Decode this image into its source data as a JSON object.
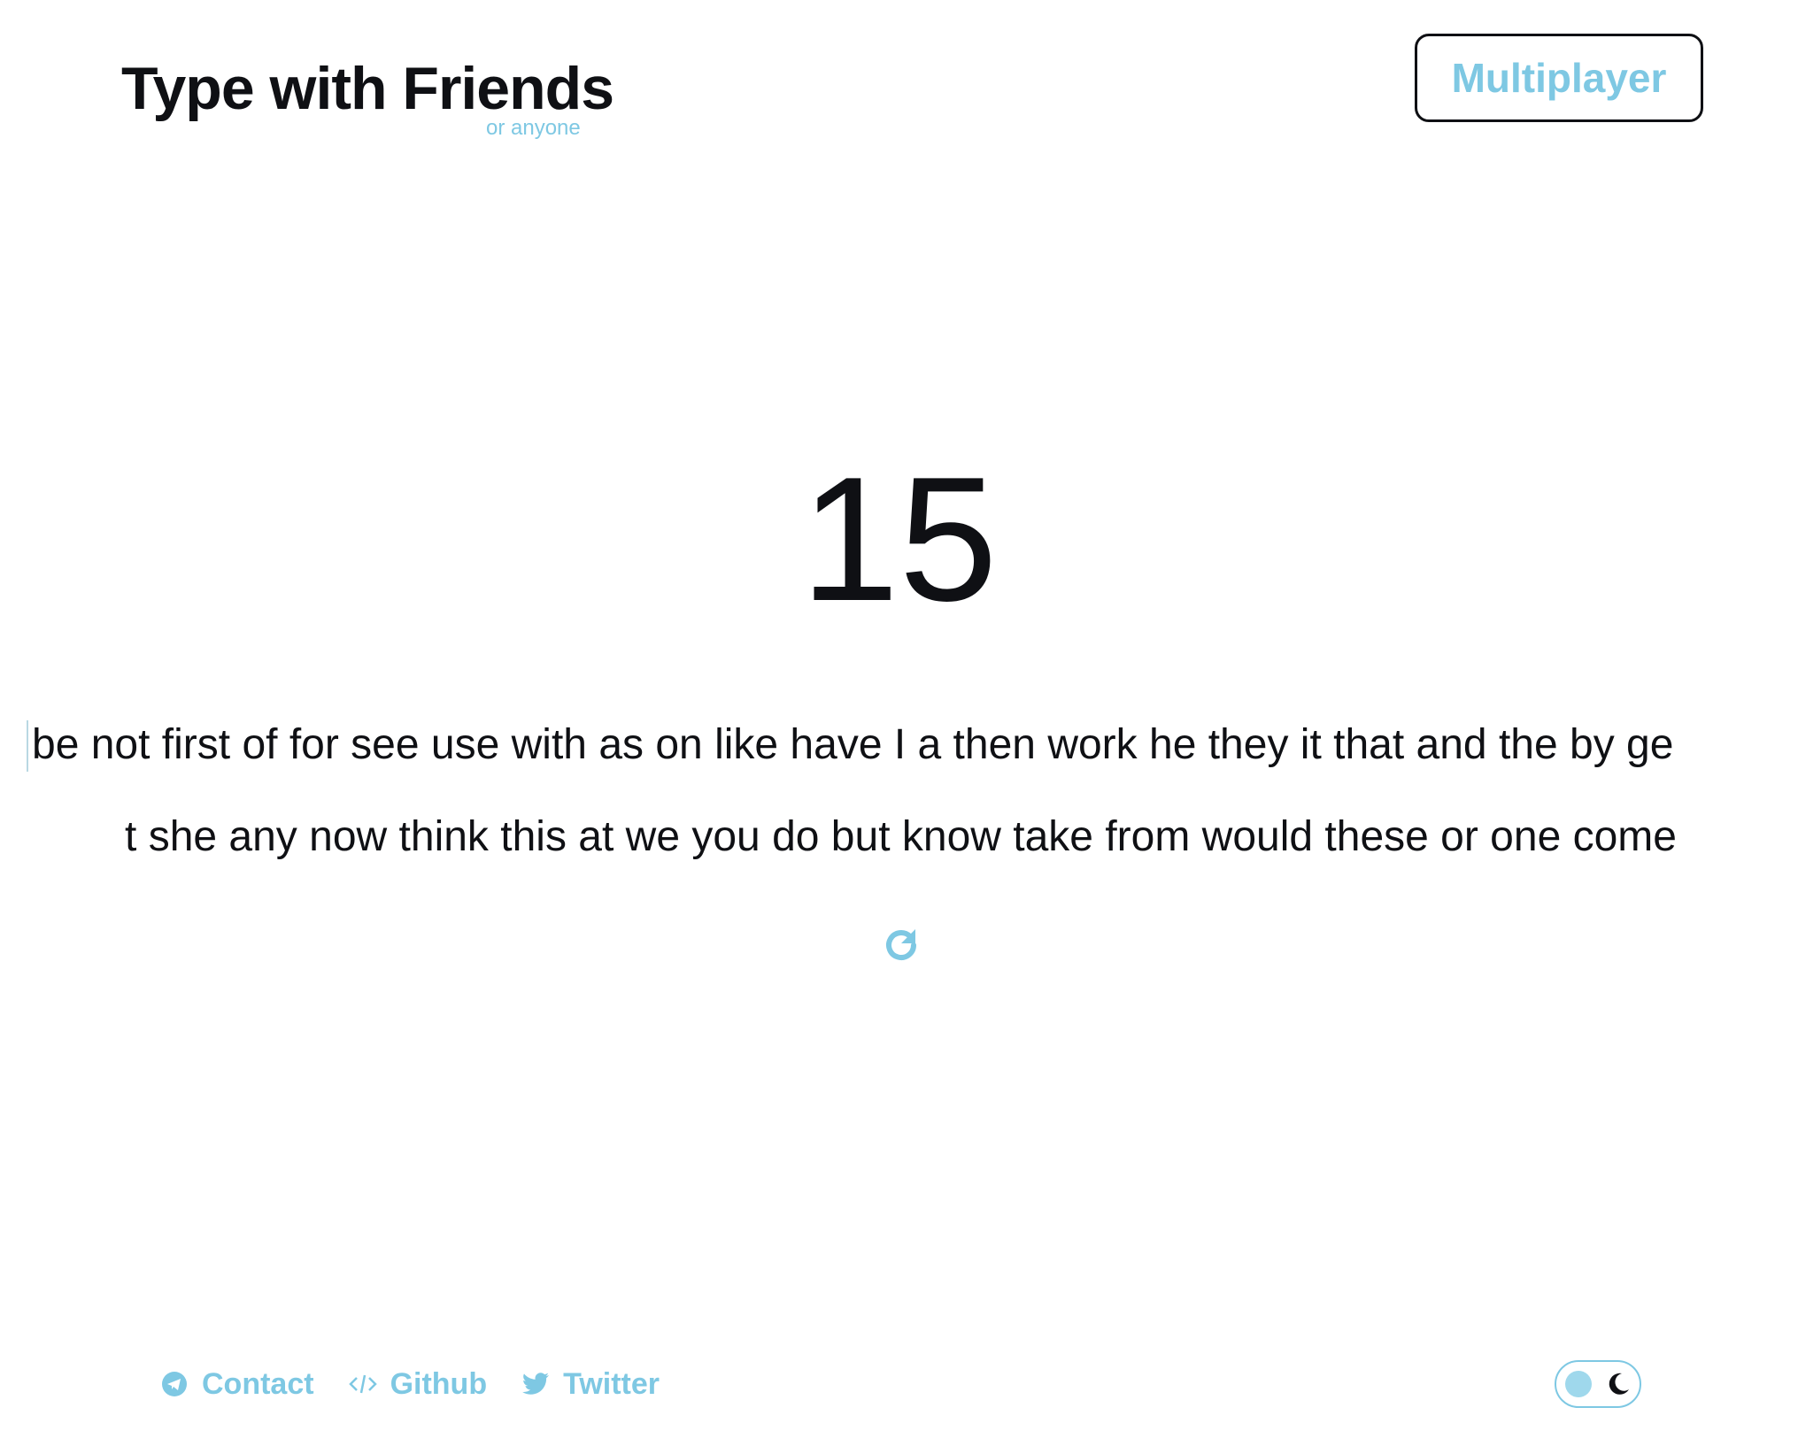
{
  "header": {
    "title": "Type with Friends",
    "subtitle": "or anyone",
    "multiplayer_label": "Multiplayer"
  },
  "test": {
    "timer": "15",
    "words_line_1": "be not first of for see use with as on like have I a then work he they it that and the by ge",
    "words_line_2": "t she any now think this at we you do but know take from would these or one come",
    "restart_icon": "refresh-icon"
  },
  "footer": {
    "links": [
      {
        "label": "Contact",
        "icon": "telegram-icon"
      },
      {
        "label": "Github",
        "icon": "code-icon"
      },
      {
        "label": "Twitter",
        "icon": "twitter-icon"
      }
    ],
    "theme_toggle": {
      "icon_on": "sun-dot-icon",
      "icon_off": "moon-icon"
    }
  },
  "colors": {
    "accent": "#7ec8e3",
    "text": "#0f1014",
    "background": "#ffffff"
  }
}
